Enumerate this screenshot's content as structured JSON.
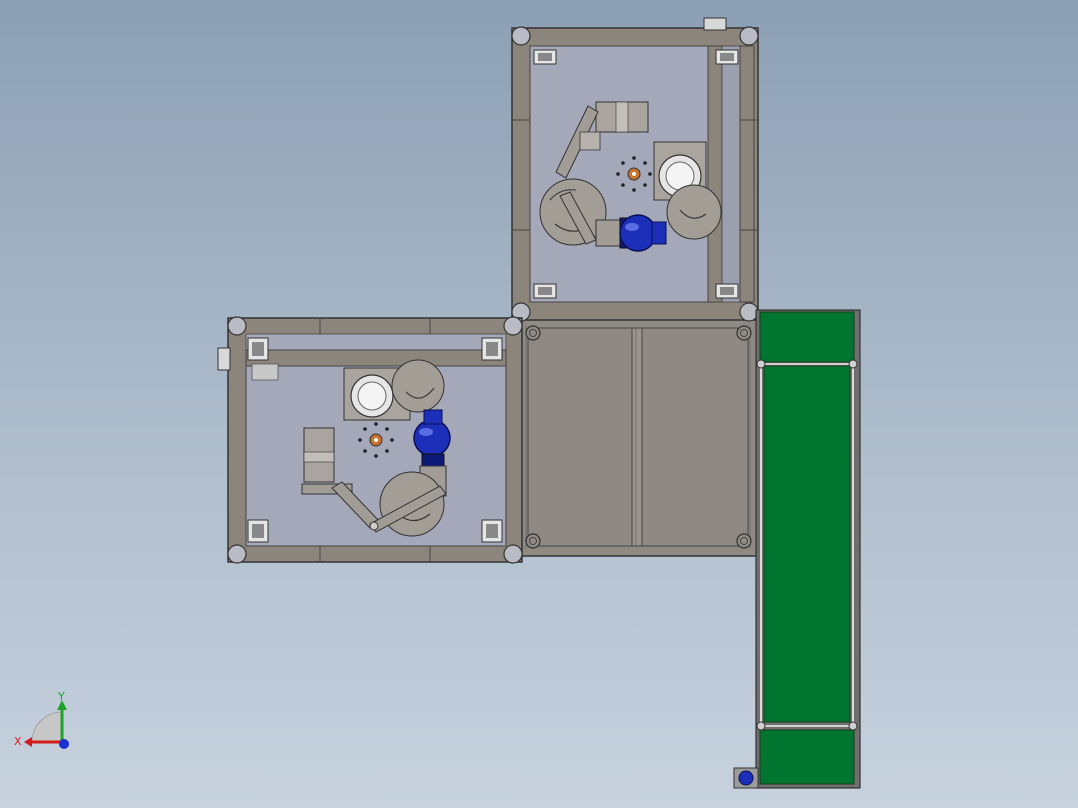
{
  "viewport": {
    "background_top": "#8c9fb4",
    "background_bottom": "#c7d2de"
  },
  "colors": {
    "frame": "#8b857b",
    "frame_edge": "#3a3a3a",
    "plate": "#a4a8b8",
    "panel": "#8f8b84",
    "motor": "#1c2fb8",
    "motor_dark": "#0d1877",
    "hub": "#c8742e",
    "conveyor_belt": "#00752f",
    "conveyor_frame": "#6f6f6f",
    "corner_cap": "#b9bcc4"
  },
  "triad": {
    "x_label": "X",
    "y_label": "Y",
    "x_color": "#d21c1c",
    "y_color": "#1fa32a",
    "z_color": "#1c2fd2"
  },
  "components": {
    "upper_station": "machine-station-upper",
    "lower_station": "machine-station-lower",
    "center_frame": "center-frame",
    "conveyor": "belt-conveyor"
  }
}
